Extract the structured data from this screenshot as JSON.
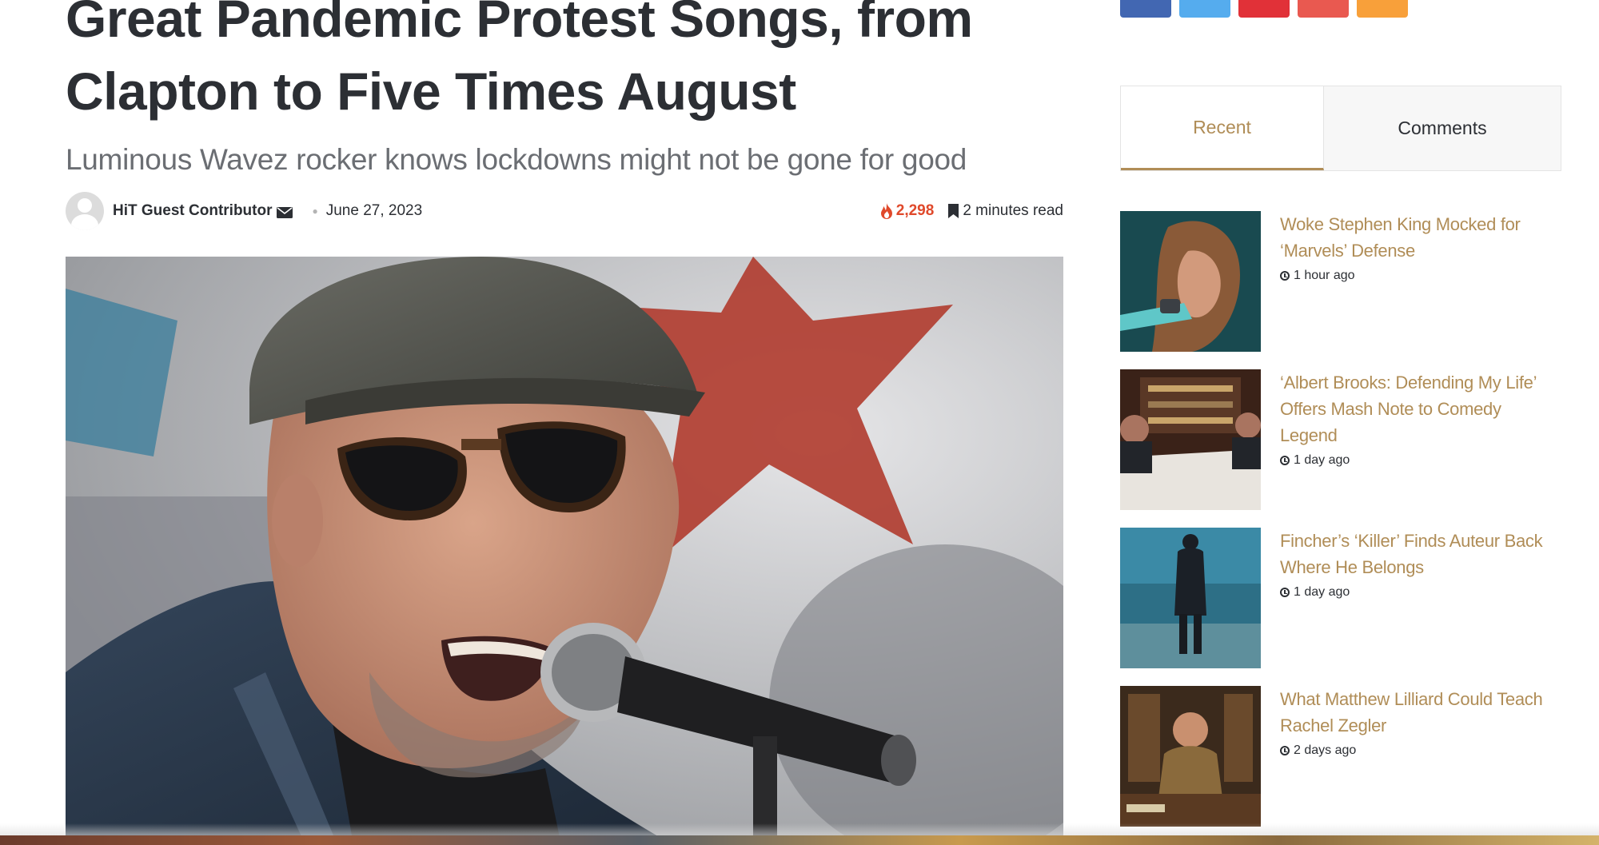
{
  "article": {
    "title": "Great Pandemic Protest Songs, from Clapton to Five Times August",
    "subtitle": "Luminous Wavez rocker knows lockdowns might not be gone for good",
    "author": "HiT Guest Contributor",
    "date": "June 27, 2023",
    "views": "2,298",
    "read_time": "2 minutes read"
  },
  "share_buttons": [
    {
      "icon": "facebook-icon",
      "color": "#4267b2"
    },
    {
      "icon": "twitter-icon",
      "color": "#55acee"
    },
    {
      "icon": "pinterest-icon",
      "color": "#e13138"
    },
    {
      "icon": "email-icon",
      "color": "#e95950"
    },
    {
      "icon": "rss-icon",
      "color": "#f8a03a"
    }
  ],
  "sidebar": {
    "tabs": {
      "recent": "Recent",
      "comments": "Comments"
    },
    "recent_posts": [
      {
        "title": "Woke Stephen King Mocked for ‘Marvels’ Defense",
        "time": "1 hour ago"
      },
      {
        "title": "‘Albert Brooks: Defending My Life’ Offers Mash Note to Comedy Legend",
        "time": "1 day ago"
      },
      {
        "title": "Fincher’s ‘Killer’ Finds Auteur Back Where He Belongs",
        "time": "1 day ago"
      },
      {
        "title": "What Matthew Lilliard Could Teach Rachel Zegler",
        "time": "2 days ago"
      }
    ]
  },
  "colors": {
    "accent": "#b08d57",
    "views": "#e0492b",
    "text": "#2c2f34"
  }
}
